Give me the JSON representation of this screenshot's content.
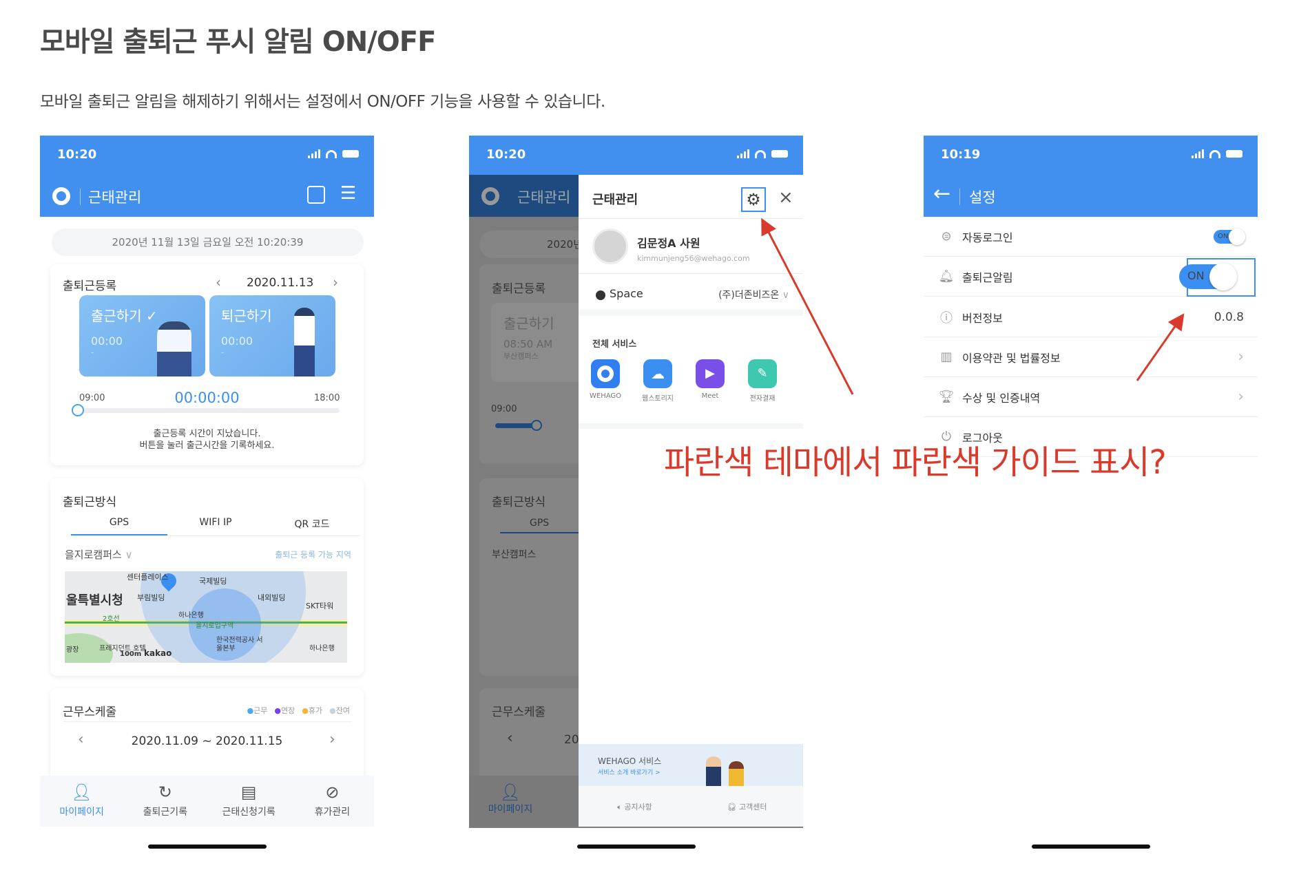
{
  "title": "모바일 출퇴근 푸시 알림 ON/OFF",
  "subtitle": "모바일 출퇴근 알림을 해제하기 위해서는 설정에서 ON/OFF 기능을 사용할 수 있습니다.",
  "annotation": "파란색 테마에서 파란색 가이드 표시?",
  "colors": {
    "brand": "#4190f0",
    "annotation": "#d93a2b"
  },
  "phone1": {
    "time": "10:20",
    "header_title": "근태관리",
    "datetime": "2020년 11월 13일 금요일 오전 10:20:39",
    "register": {
      "title": "출퇴근등록",
      "date": "2020.11.13",
      "checkin_label": "출근하기 ✓",
      "checkin_time": "00:00",
      "checkin_sub": "-",
      "checkout_label": "퇴근하기",
      "checkout_time": "00:00",
      "checkout_sub": "-",
      "start": "09:00",
      "elapsed": "00:00:00",
      "end": "18:00",
      "message1": "출근등록 시간이 지났습니다.",
      "message2": "버튼을 눌러 출근시간을 기록하세요."
    },
    "method": {
      "title": "출퇴근방식",
      "tabs": [
        "GPS",
        "WIFI IP",
        "QR 코드"
      ],
      "active_tab": "GPS",
      "campus": "을지로캠퍼스",
      "area_link": "출퇴근 등록 가능 지역",
      "map_labels": [
        "센터플레이스",
        "국제빌딩",
        "울특별시청",
        "부림빌딩",
        "내외빌딩",
        "SKT타워",
        "하나은행",
        "을지로입구역",
        "한국전력공사 서울본부",
        "2호선",
        "광장",
        "프레지던트 호텔",
        "100m",
        "kakao",
        "하나은행"
      ]
    },
    "schedule": {
      "title": "근무스케줄",
      "legend": [
        {
          "label": "근무",
          "color": "#4aa8f5"
        },
        {
          "label": "연장",
          "color": "#7b3ff2"
        },
        {
          "label": "휴가",
          "color": "#f5b53a"
        },
        {
          "label": "잔여",
          "color": "#c8d3dd"
        }
      ],
      "range": "2020.11.09 ~ 2020.11.15"
    },
    "tabs": [
      {
        "label": "마이페이지",
        "icon": "person-icon",
        "active": true
      },
      {
        "label": "출퇴근기록",
        "icon": "history-icon"
      },
      {
        "label": "근태신청기록",
        "icon": "document-icon"
      },
      {
        "label": "휴가관리",
        "icon": "vacation-icon"
      }
    ]
  },
  "phone2": {
    "time": "10:20",
    "bg": {
      "header_title": "근태관리",
      "date_partial": "2020년",
      "register_title": "출퇴근등록",
      "checkin_label": "출근하기",
      "checkin_time": "08:50 AM",
      "checkin_place": "부산캠퍼스",
      "start": "09:00",
      "method_title": "출퇴근방식",
      "tab": "GPS",
      "campus": "부산캠퍼스",
      "schedule_title": "근무스케줄",
      "range_partial": "20",
      "tab_label": "마이페이지"
    },
    "drawer": {
      "title": "근태관리",
      "user_name": "김문정A 사원",
      "email": "kimmunjeng56@wehago.com",
      "space_label": "Space",
      "company": "(주)더존비즈온",
      "services_title": "전체 서비스",
      "services": [
        {
          "label": "WEHAGO",
          "color": "#2f7ff0"
        },
        {
          "label": "웹스토리지",
          "color": "#3b8ff0"
        },
        {
          "label": "Meet",
          "color": "#7a4fe8"
        },
        {
          "label": "전자결재",
          "color": "#3fc8b0"
        }
      ],
      "banner_title": "WEHAGO 서비스",
      "banner_link": "서비스 소개 바로가기 >",
      "notice": "공지사항",
      "support": "고객센터"
    }
  },
  "phone3": {
    "time": "10:19",
    "header_title": "설정",
    "rows": [
      {
        "label": "자동로그인",
        "icon": "auto-login-icon",
        "toggle": "ON"
      },
      {
        "label": "출퇴근알림",
        "icon": "bell-icon",
        "toggle": "ON"
      },
      {
        "label": "버전정보",
        "icon": "info-icon",
        "value": "0.0.8"
      },
      {
        "label": "이용약관 및 법률정보",
        "icon": "book-icon"
      },
      {
        "label": "수상 및 인증내역",
        "icon": "trophy-icon"
      },
      {
        "label": "로그아웃",
        "icon": "power-icon"
      }
    ]
  }
}
